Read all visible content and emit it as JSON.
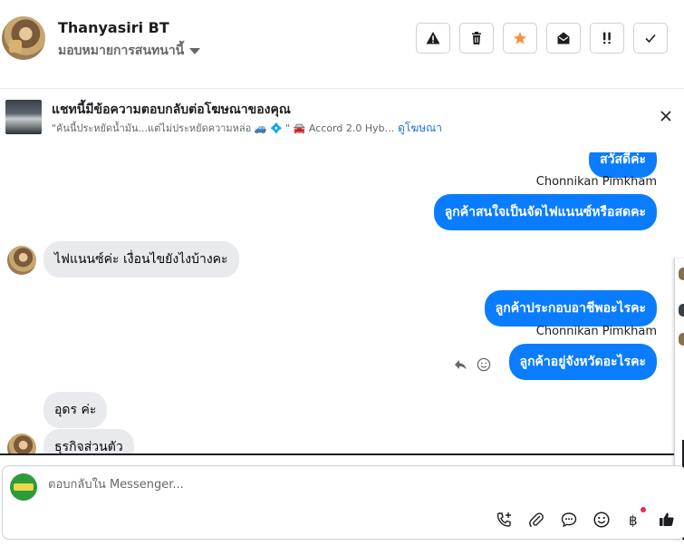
{
  "header": {
    "contact_name": "Thanyasiri BT",
    "assign_label": "มอบหมายการสนทนานี้",
    "actions": [
      "spam-icon",
      "trash-icon",
      "star-icon",
      "mark-unread-icon",
      "follow-up-icon",
      "done-icon"
    ]
  },
  "ad_banner": {
    "title": "แชทนี้มีข้อความตอบกลับต่อโฆษณาของคุณ",
    "subtitle": "\"คันนี้ประหยัดน้ำมัน...แต่ไม่ประหยัดความหล่อ 🚙 💠 \" 🚘 Accord 2.0 Hyb...",
    "link": "ดูโฆษณา"
  },
  "messages": [
    {
      "dir": "out",
      "text": "สวัสดีค่ะ"
    },
    {
      "dir": "meta",
      "text": "Chonnikan Pimkham"
    },
    {
      "dir": "out",
      "text": "ลูกค้าสนใจเป็นจัดไฟแนนซ์หรือสดคะ"
    },
    {
      "dir": "in",
      "text": "ไฟแนนซ์ค่ะ เงื่อนไขยังไงบ้างคะ"
    },
    {
      "dir": "out",
      "text": "ลูกค้าประกอบอาชีพอะไรคะ"
    },
    {
      "dir": "meta",
      "text": "Chonnikan Pimkham"
    },
    {
      "dir": "out",
      "text": "ลูกค้าอยู่จังหวัดอะไรคะ"
    },
    {
      "dir": "in",
      "text": "อุดร ค่ะ"
    },
    {
      "dir": "in",
      "text": "ธุรกิจส่วนตัว"
    }
  ],
  "composer": {
    "placeholder": "ตอบกลับใน Messenger...",
    "tools": [
      "call-add-icon",
      "attachment-icon",
      "saved-reply-icon",
      "emoji-icon",
      "baht-payment-icon",
      "thumbs-up-icon"
    ]
  },
  "colors": {
    "accent": "#0a7cff",
    "star": "#f7923b",
    "link": "#216fdb"
  }
}
